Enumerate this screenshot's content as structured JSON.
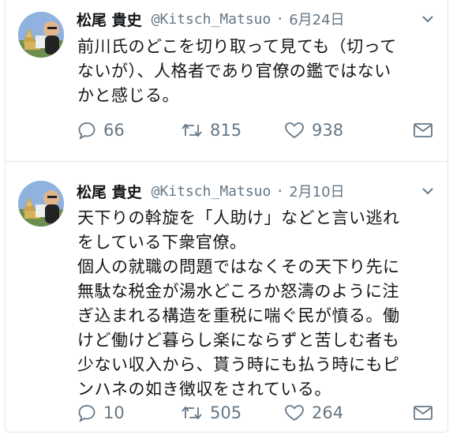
{
  "tweets": [
    {
      "name": "松尾 貴史",
      "handle": "@Kitsch_Matsuo",
      "separator": "·",
      "date": "6月24日",
      "text": "前川氏のどこを切り取って見ても（切って\nないが）、人格者であり官僚の鑑ではない\nかと感じる。",
      "replies": "66",
      "retweets": "815",
      "likes": "938"
    },
    {
      "name": "松尾 貴史",
      "handle": "@Kitsch_Matsuo",
      "separator": "·",
      "date": "2月10日",
      "text": "天下りの斡旋を「人助け」などと言い逃れ\nをしている下衆官僚。\n個人の就職の問題ではなくその天下り先に\n無駄な税金が湯水どころか怒濤のように注\nぎ込まれる構造を重税に喘ぐ民が憤る。働\nけど働けど暮らし楽にならずと苦しむ者も\n少ない収入から、貰う時にも払う時にもピ\nンハネの如き徴収をされている。",
      "replies": "10",
      "retweets": "505",
      "likes": "264"
    }
  ],
  "icons": {
    "reply": "reply-icon",
    "retweet": "retweet-icon",
    "like": "heart-icon",
    "dm": "mail-icon",
    "caret": "chevron-down-icon"
  },
  "colors": {
    "text": "#14171a",
    "meta": "#657786",
    "divider": "#e3e6e8"
  }
}
